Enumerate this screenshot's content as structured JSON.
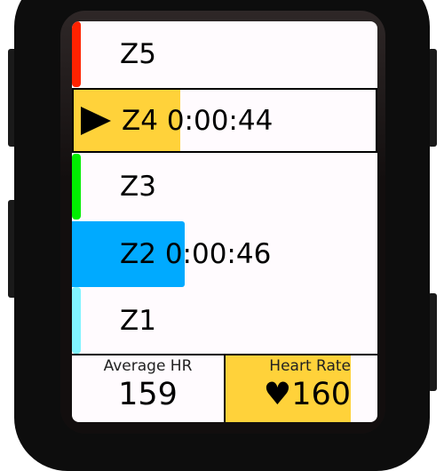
{
  "zones": [
    {
      "id": "Z5",
      "label": "Z5",
      "time": "",
      "color": "#ff2200",
      "selected": false
    },
    {
      "id": "Z4",
      "label": "Z4 0:00:44",
      "time": "0:00:44",
      "color": "#ffd23a",
      "selected": true
    },
    {
      "id": "Z3",
      "label": "Z3",
      "time": "",
      "color": "#00ee00",
      "selected": false
    },
    {
      "id": "Z2",
      "label": "Z2 0:00:46",
      "time": "0:00:46",
      "color": "#00aaff",
      "selected": false
    },
    {
      "id": "Z1",
      "label": "Z1",
      "time": "",
      "color": "#80f4ff",
      "selected": false
    }
  ],
  "fields": {
    "average_hr": {
      "title": "Average HR",
      "value": "159"
    },
    "heart_rate": {
      "title": "Heart Rate",
      "icon": "heart-icon",
      "value": "160",
      "zone_color": "#ffd23a"
    }
  }
}
